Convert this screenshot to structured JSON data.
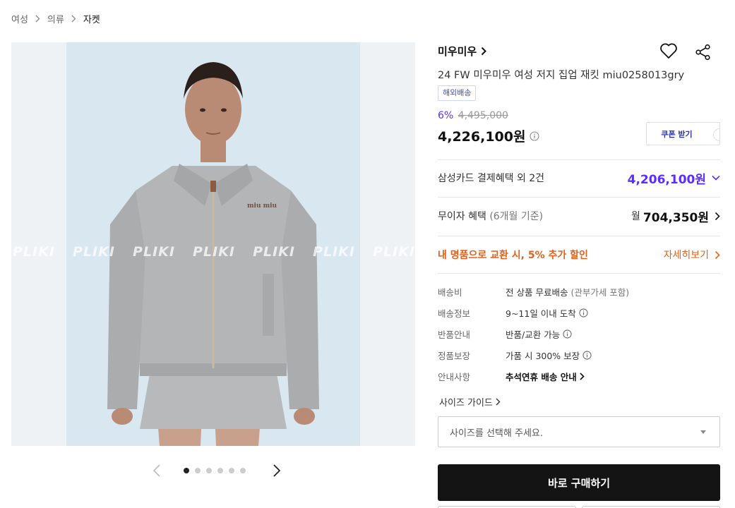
{
  "breadcrumb": [
    "여성",
    "의류",
    "자켓"
  ],
  "gallery": {
    "watermark": [
      "PLIKI",
      "PLIKI",
      "PLIKI",
      "PLIKI",
      "PLIKI",
      "PLIKI",
      "PLIKI"
    ],
    "garment_logo": "miu miu",
    "active_index": 0,
    "total": 6
  },
  "product": {
    "brand": "미우미우",
    "title": "24 FW 미우미우 여성 저지 집업 재킷 miu0258013gry",
    "tag": "해외배송",
    "discount_rate": "6%",
    "original_price": "4,495,000",
    "price": "4,226,100원",
    "coupon_label": "쿠폰 받기"
  },
  "benefits": {
    "card_label": "삼성카드 결제혜택 외 2건",
    "card_price": "4,206,100원",
    "install_label": "무이자 혜택",
    "install_note": "(6개월 기준)",
    "install_prefix": "월",
    "install_amount": "704,350원",
    "trade_in": "내 명품으로 교환 시, 5% 추가 할인",
    "trade_more": "자세히보기"
  },
  "details": [
    {
      "key": "배송비",
      "value": "전 상품 무료배송",
      "note": "(관부가세 포함)"
    },
    {
      "key": "배송정보",
      "value": "9~11일 이내 도착"
    },
    {
      "key": "반품안내",
      "value": "반품/교환 가능"
    },
    {
      "key": "정품보장",
      "value": "가품 시 300% 보장"
    },
    {
      "key": "안내사항",
      "value": "추석연휴 배송 안내"
    }
  ],
  "size_guide": "사이즈 가이드",
  "size_placeholder": "사이즈를 선택해 주세요.",
  "buy_label": "바로 구매하기",
  "colors": {
    "accent": "#5b2dff",
    "trade": "#e0621d",
    "tag": "#3b4fd8",
    "buy_bg": "#141414"
  }
}
